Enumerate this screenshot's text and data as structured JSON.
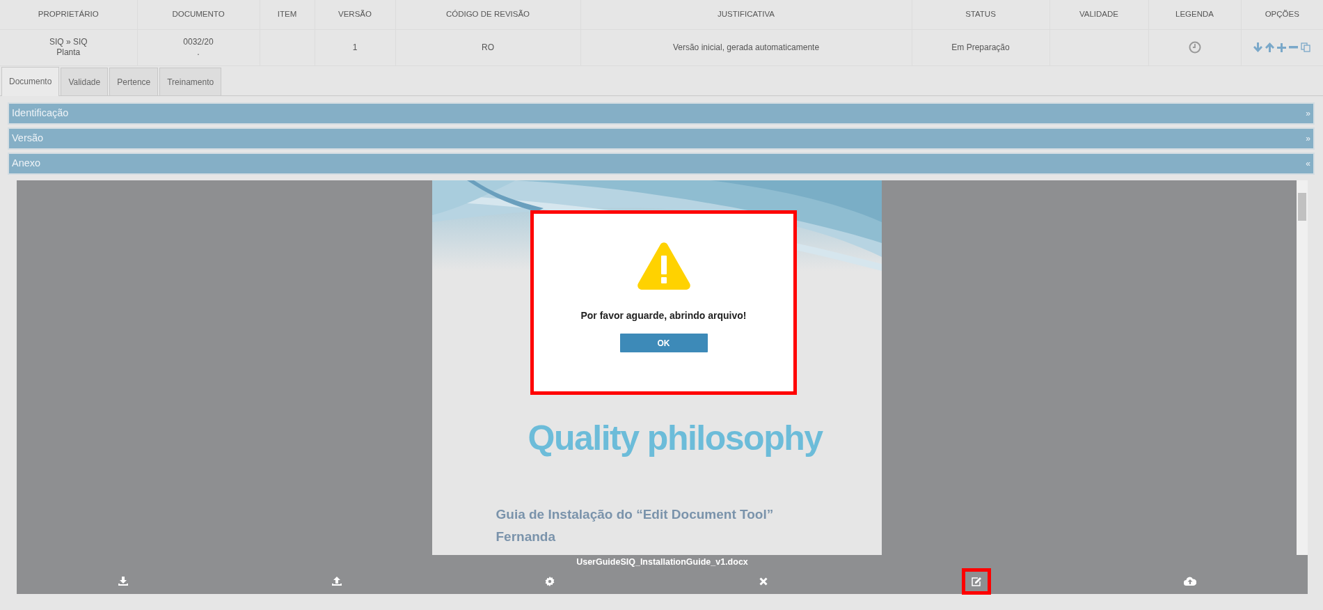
{
  "table": {
    "columns": [
      "PROPRIETÁRIO",
      "DOCUMENTO",
      "ITEM",
      "VERSÃO",
      "CÓDIGO DE REVISÃO",
      "JUSTIFICATIVA",
      "STATUS",
      "VALIDADE",
      "LEGENDA",
      "OPÇÕES"
    ],
    "rows": [
      {
        "owner": [
          "SIQ » SIQ",
          "Planta"
        ],
        "document": [
          "0032/20",
          "."
        ],
        "version": "1",
        "revision_code": "RO",
        "justification": "Versão inicial, gerada automaticamente",
        "status": "Em Preparação"
      }
    ]
  },
  "tabs": [
    {
      "label": "Documento",
      "selected": true
    },
    {
      "label": "Validade",
      "selected": false
    },
    {
      "label": "Pertence",
      "selected": false
    },
    {
      "label": "Treinamento",
      "selected": false
    }
  ],
  "panels": [
    {
      "title": "Identificação",
      "toggle": "»"
    },
    {
      "title": "Versão",
      "toggle": "»"
    },
    {
      "title": "Anexo",
      "toggle": "«"
    }
  ],
  "viewer": {
    "document_page": {
      "tagline": "Quality philosophy",
      "heading": "Guia de Instalação do “Edit Document Tool”",
      "author": "Fernanda"
    },
    "file_name": "UserGuideSIQ_InstallationGuide_v1.docx",
    "toolbar": [
      {
        "highlighted": false
      },
      {
        "highlighted": false
      },
      {
        "highlighted": false
      },
      {
        "highlighted": false
      },
      {
        "highlighted": true
      },
      {
        "highlighted": false
      }
    ]
  },
  "dialog": {
    "highlighted": true,
    "message": "Por favor aguarde, abrindo arquivo!",
    "button": "OK"
  }
}
